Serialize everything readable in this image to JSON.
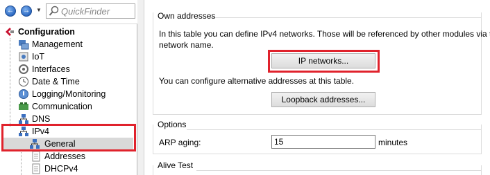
{
  "toolbar": {
    "back_icon": "back-arrow-icon",
    "forward_icon": "forward-arrow-icon",
    "quickfinder_placeholder": "QuickFinder"
  },
  "tree": {
    "root_label": "Configuration",
    "items": [
      {
        "label": "Management",
        "icon": "management-icon"
      },
      {
        "label": "IoT",
        "icon": "iot-icon"
      },
      {
        "label": "Interfaces",
        "icon": "interfaces-icon"
      },
      {
        "label": "Date & Time",
        "icon": "clock-icon"
      },
      {
        "label": "Logging/Monitoring",
        "icon": "logging-icon"
      },
      {
        "label": "Communication",
        "icon": "communication-icon"
      },
      {
        "label": "DNS",
        "icon": "dns-icon"
      },
      {
        "label": "IPv4",
        "icon": "network-icon"
      },
      {
        "label": "General",
        "icon": "network-icon"
      },
      {
        "label": "Addresses",
        "icon": "page-icon"
      },
      {
        "label": "DHCPv4",
        "icon": "page-icon"
      }
    ]
  },
  "own_addresses": {
    "title": "Own addresses",
    "description_line1": "In this table you can define IPv4 networks. Those will be referenced by other modules via the",
    "description_line2": "network name.",
    "ip_networks_button": "IP networks...",
    "alt_text": "You can configure alternative addresses at this table.",
    "loopback_button": "Loopback addresses..."
  },
  "options": {
    "title": "Options",
    "arp_label": "ARP aging:",
    "arp_value": "15",
    "arp_unit": "minutes"
  },
  "alive_test": {
    "title": "Alive Test"
  },
  "colors": {
    "highlight_red": "#e0222c",
    "selected_bg": "#d9d9d9"
  }
}
